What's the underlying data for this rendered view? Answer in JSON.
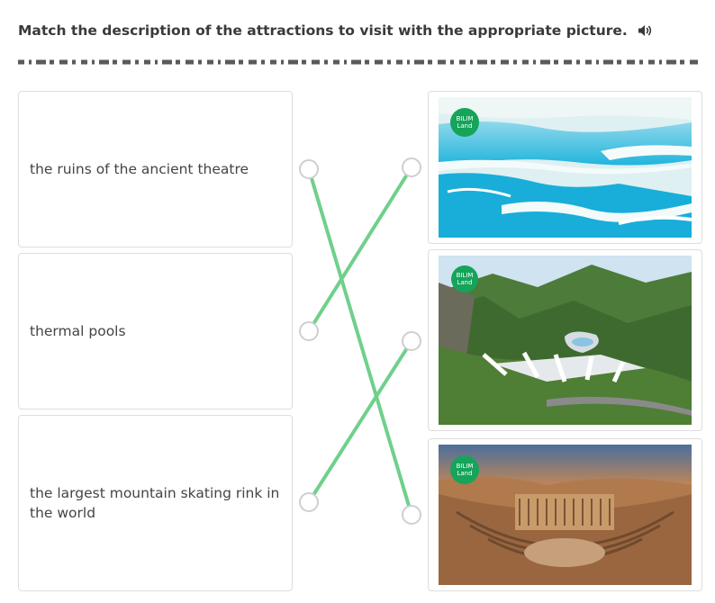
{
  "task": {
    "instruction": "Match the description of the attractions to visit with the appropriate picture."
  },
  "descriptions": [
    {
      "label": "the ruins of the ancient theatre"
    },
    {
      "label": "thermal pools"
    },
    {
      "label": "the largest mountain skating rink in the world"
    }
  ],
  "pictures": [
    {
      "badge_line1": "BILIM",
      "badge_line2": "Land",
      "subject": "thermal pools"
    },
    {
      "badge_line1": "BILIM",
      "badge_line2": "Land",
      "subject": "mountain skating rink"
    },
    {
      "badge_line1": "BILIM",
      "badge_line2": "Land",
      "subject": "ancient theatre ruins"
    }
  ],
  "connections": [
    {
      "description": 0,
      "picture": 2
    },
    {
      "description": 1,
      "picture": 0
    },
    {
      "description": 2,
      "picture": 1
    }
  ],
  "colors": {
    "connector_line": "#6fd08c",
    "badge": "#15a45a",
    "card_border": "#dedede",
    "dot_border": "#cfcfcf"
  },
  "icons": {
    "speaker": "speaker-icon"
  }
}
